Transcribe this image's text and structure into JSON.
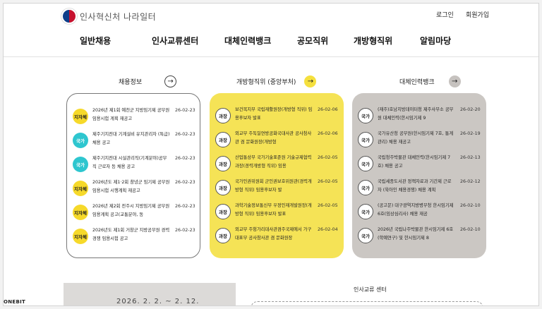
{
  "header": {
    "logo_text": "인사혁신처 나라일터",
    "login": "로그인",
    "join": "회원가입"
  },
  "nav": [
    "일반채용",
    "인사교류센터",
    "대체인력뱅크",
    "공모직위",
    "개방형직위",
    "알림마당"
  ],
  "sections": {
    "recruit": {
      "title": "채용정보",
      "arrow": "→"
    },
    "open": {
      "title": "개방형직위 (중앙부처)",
      "arrow": "→"
    },
    "bank": {
      "title": "대체인력뱅크",
      "arrow": "→"
    }
  },
  "recruit_items": [
    {
      "badge": "지자체",
      "title": "2026년 제1회 예천군 지방임기제 공무원 임용시험 계획 재공고",
      "date": "26-02-23"
    },
    {
      "badge": "국가",
      "title": "제주기지전대 기계설비 유지관리자 (특급) 채용 공고",
      "date": "26-02-23"
    },
    {
      "badge": "국가",
      "title": "제주기지전대 시설관리직(기계분야)공무직 근로자 등 채용 공고",
      "date": "26-02-23"
    },
    {
      "badge": "지자체",
      "title": "2026년도 제1·2회 창녕군 임기제 공무원 임용시험 시행계획 재공고",
      "date": "26-02-23"
    },
    {
      "badge": "지자체",
      "title": "2026년 제2회 전주시 지방임기제 공무원 임용계획 공고(교통분야, 동",
      "date": "26-02-23"
    },
    {
      "badge": "지자체",
      "title": "2026년도 제1회 거창군 지방공무원 경력경쟁 임용시험 공고",
      "date": "26-02-23"
    }
  ],
  "open_items": [
    {
      "badge": "과장",
      "title": "보건복지부 국립재활원장(개방형 직위) 임용후보자 발표",
      "date": "26-02-06"
    },
    {
      "badge": "과장",
      "title": "외교부 주독일연방공화국대사관 공사참사관 겸 문화원장(개방형",
      "date": "26-02-06"
    },
    {
      "badge": "과장",
      "title": "산업통상부 국가기술표준원 기술규제협력과장(경력개방형 직위) 임용",
      "date": "26-02-05"
    },
    {
      "badge": "과장",
      "title": "국가인권위원회 군인권보호위원관(경력개방형 직위) 임용후보자 발",
      "date": "26-02-05"
    },
    {
      "badge": "과장",
      "title": "과학기술정보통신부 우정인재개발원장(개방형 직위) 임용후보자 발표",
      "date": "26-02-05"
    },
    {
      "badge": "과장",
      "title": "외교부 주헝가리대사관겸주국제에서 가구대표부 공사참사관 겸 문화원장",
      "date": "26-02-04"
    }
  ],
  "bank_items": [
    {
      "badge": "국가",
      "title": "(재주)호남지방데이터청 제주사무소 공무원 대체인력(한시임기제 9",
      "date": "26-02-20"
    },
    {
      "badge": "국가",
      "title": "국가유산청 공무원(한시임기제 7호, 통계관리) 채용 재공고",
      "date": "26-02-19"
    },
    {
      "badge": "국가",
      "title": "국립청주박물관 대체인력(한시임기제 7호) 채용 공고",
      "date": "26-02-13"
    },
    {
      "badge": "국가",
      "title": "국립세종도서관 정책자료과 기간제 근로자 (육아인 채용경쟁) 채용 계획",
      "date": "26-02-12"
    },
    {
      "badge": "국가",
      "title": "(공고문) 대구광역지방병무청 한시임기제6호(임상심리사) 채용 재공",
      "date": "26-02-10"
    },
    {
      "badge": "국가",
      "title": "2026년 국립나주박물관 한시임기제 6호(학예연구) 및 한시임기제 8",
      "date": "26-02-10"
    }
  ],
  "bottom": {
    "period": "2026. 2. 2. ~ 2. 12.",
    "exchange_title": "인사교류 센터",
    "brand": "ONEBIT"
  },
  "colors": {
    "yellow_panel": "#f5e356",
    "gray_panel": "#cbc7c3",
    "badge_local": "#f6d92a",
    "badge_national": "#2ec6cf"
  }
}
